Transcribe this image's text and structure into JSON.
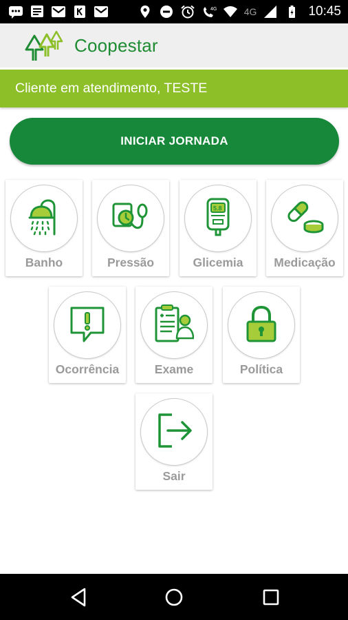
{
  "status_bar": {
    "network_label": "4G",
    "network_label_2": "4G",
    "time": "10:45",
    "icons": [
      "chat-icon",
      "notes-icon",
      "gmail-icon",
      "app-icon",
      "gmail-icon",
      "location-icon",
      "dnd-icon",
      "alarm-icon",
      "wifi-call-icon",
      "wifi-icon",
      "signal-icon",
      "battery-icon"
    ]
  },
  "app_bar": {
    "title": "Coopestar",
    "logo_icon": "trees-logo-icon"
  },
  "client_banner": {
    "text": "Cliente em atendimento, TESTE"
  },
  "start_button": {
    "label": "INICIAR JORNADA"
  },
  "menu": {
    "items": [
      {
        "label": "Banho",
        "icon": "shower-icon"
      },
      {
        "label": "Pressão",
        "icon": "blood-pressure-icon"
      },
      {
        "label": "Glicemia",
        "icon": "glucometer-icon"
      },
      {
        "label": "Medicação",
        "icon": "pills-icon"
      },
      {
        "label": "Ocorrência",
        "icon": "alert-message-icon"
      },
      {
        "label": "Exame",
        "icon": "medical-report-icon"
      },
      {
        "label": "Política",
        "icon": "padlock-icon"
      },
      {
        "label": "Sair",
        "icon": "logout-icon"
      }
    ]
  },
  "colors": {
    "brand_green": "#17873a",
    "banner_green": "#8dbf29",
    "icon_green": "#1e9437",
    "label_gray": "#9a9a9a"
  },
  "nav_bar": {
    "icons": [
      "back-icon",
      "home-icon",
      "recents-icon"
    ]
  }
}
